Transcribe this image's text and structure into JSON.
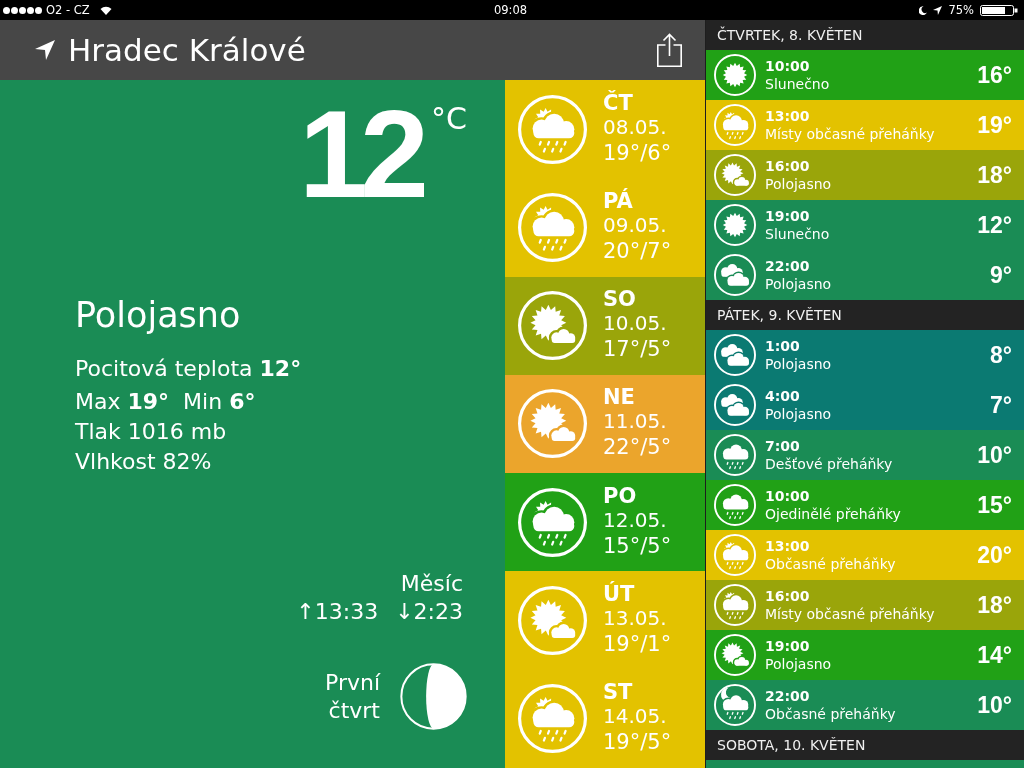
{
  "status_bar": {
    "carrier": "O2 - CZ",
    "time": "09:08",
    "battery": "75%"
  },
  "header": {
    "location": "Hradec Králové"
  },
  "current": {
    "temperature": "12",
    "unit": "°C",
    "condition": "Polojasno",
    "details": [
      "Pocitová teplota **12°**",
      "Max **19°**  Min **6°**",
      "Tlak 1016 mb",
      "Vlhkost 82%"
    ],
    "moon": {
      "title": "Měsíc",
      "rise": "↑13:33",
      "set": "↓2:23",
      "phase": "První čtvrt"
    }
  },
  "days": [
    {
      "day": "ČT",
      "date": "08.05.",
      "temps": "19°/6°",
      "kind": "sunrain",
      "color": "#e3c200"
    },
    {
      "day": "PÁ",
      "date": "09.05.",
      "temps": "20°/7°",
      "kind": "sunrain",
      "color": "#e3c200"
    },
    {
      "day": "SO",
      "date": "10.05.",
      "temps": "17°/5°",
      "kind": "suncloud",
      "color": "#9aa50a"
    },
    {
      "day": "NE",
      "date": "11.05.",
      "temps": "22°/5°",
      "kind": "suncloud",
      "color": "#eba52c"
    },
    {
      "day": "PO",
      "date": "12.05.",
      "temps": "15°/5°",
      "kind": "sunrain",
      "color": "#21a116"
    },
    {
      "day": "ÚT",
      "date": "13.05.",
      "temps": "19°/1°",
      "kind": "suncloud",
      "color": "#e3c200"
    },
    {
      "day": "ST",
      "date": "14.05.",
      "temps": "19°/5°",
      "kind": "sunrain",
      "color": "#e3c200"
    }
  ],
  "hourly": [
    {
      "title": "ČTVRTEK, 8. KVĚTEN",
      "hours": [
        {
          "time": "10:00",
          "condition": "Slunečno",
          "temp": "16°",
          "kind": "sun",
          "color": "#21a116"
        },
        {
          "time": "13:00",
          "condition": "Místy občasné přeháňky",
          "temp": "19°",
          "kind": "sunrain",
          "color": "#e3c200"
        },
        {
          "time": "16:00",
          "condition": "Polojasno",
          "temp": "18°",
          "kind": "suncloud",
          "color": "#9aa50a"
        },
        {
          "time": "19:00",
          "condition": "Slunečno",
          "temp": "12°",
          "kind": "sun",
          "color": "#1a8c55"
        },
        {
          "time": "22:00",
          "condition": "Polojasno",
          "temp": "9°",
          "kind": "clouds",
          "color": "#1a8c55"
        }
      ]
    },
    {
      "title": "PÁTEK, 9. KVĚTEN",
      "hours": [
        {
          "time": "1:00",
          "condition": "Polojasno",
          "temp": "8°",
          "kind": "clouds",
          "color": "#0b7a72"
        },
        {
          "time": "4:00",
          "condition": "Polojasno",
          "temp": "7°",
          "kind": "clouds",
          "color": "#0b7a72"
        },
        {
          "time": "7:00",
          "condition": "Dešťové přeháňky",
          "temp": "10°",
          "kind": "rain",
          "color": "#1a8c55"
        },
        {
          "time": "10:00",
          "condition": "Ojedinělé přeháňky",
          "temp": "15°",
          "kind": "rain",
          "color": "#21a116"
        },
        {
          "time": "13:00",
          "condition": "Občasné přeháňky",
          "temp": "20°",
          "kind": "sunrain",
          "color": "#e3c200"
        },
        {
          "time": "16:00",
          "condition": "Místy občasné přeháňky",
          "temp": "18°",
          "kind": "sunrain",
          "color": "#9aa50a"
        },
        {
          "time": "19:00",
          "condition": "Polojasno",
          "temp": "14°",
          "kind": "suncloud",
          "color": "#21a116"
        },
        {
          "time": "22:00",
          "condition": "Občasné přeháňky",
          "temp": "10°",
          "kind": "moonrain",
          "color": "#1a8c55"
        }
      ]
    },
    {
      "title": "SOBOTA, 10. KVĚTEN",
      "hours": [
        {
          "color": "#1a8c55"
        }
      ]
    }
  ]
}
